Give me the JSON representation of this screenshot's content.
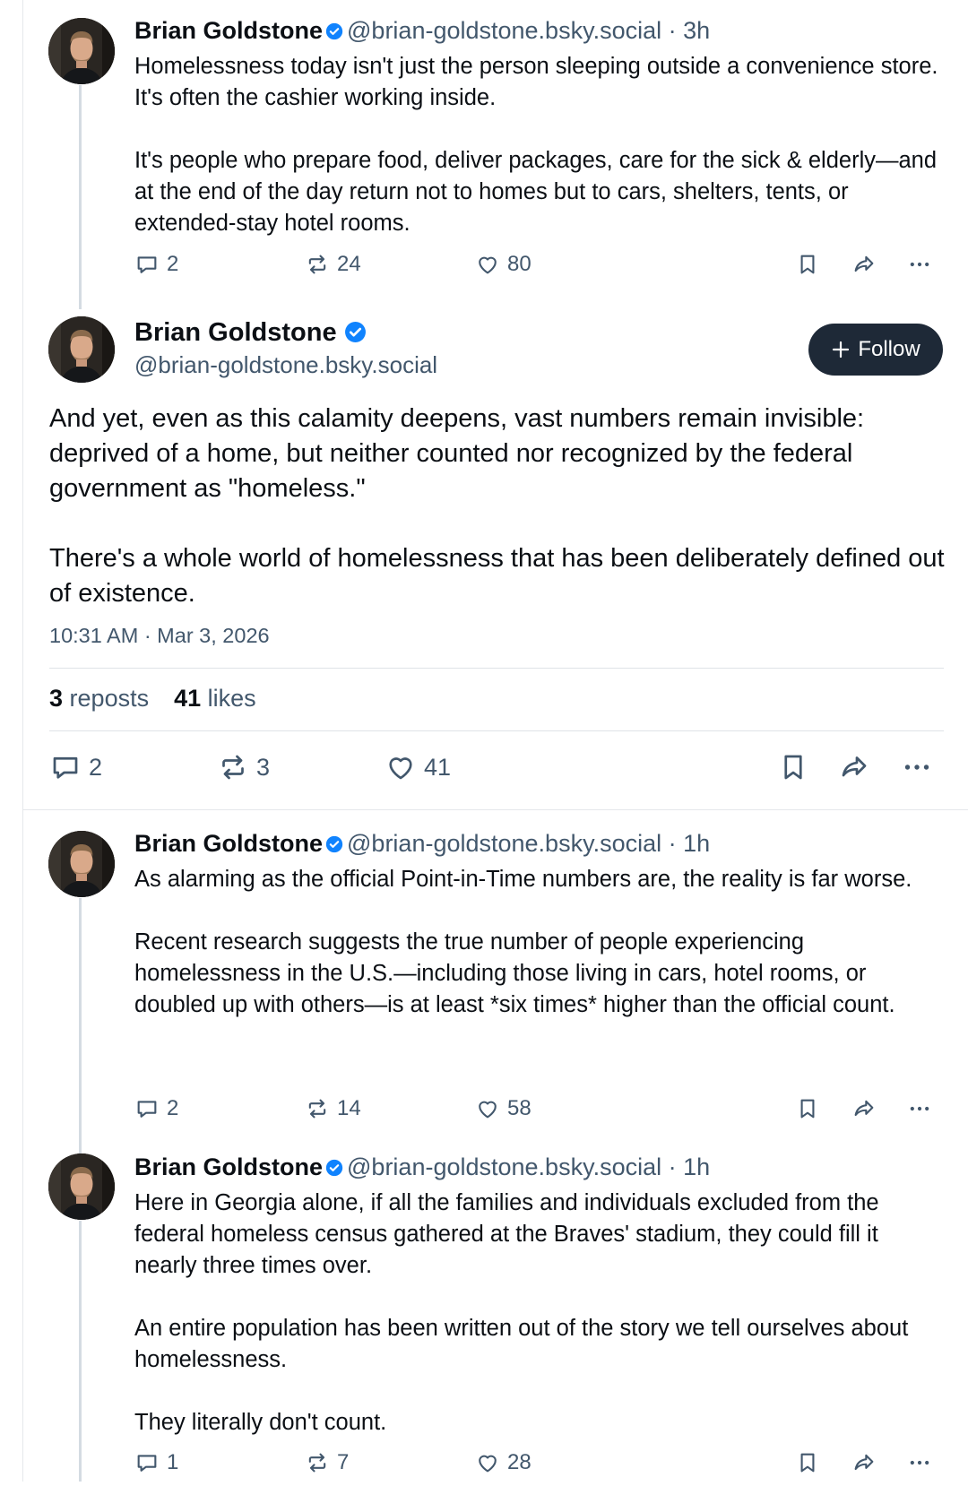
{
  "author": {
    "name": "Brian Goldstone",
    "handle": "@brian-goldstone.bsky.social",
    "verified": true
  },
  "colors": {
    "verified_badge": "#1083fe",
    "follow_bg": "#1e2937",
    "muted": "#42576c"
  },
  "icons": {
    "reply": "reply-icon",
    "repost": "repost-icon",
    "like": "heart-icon",
    "bookmark": "bookmark-icon",
    "share": "share-icon",
    "more": "more-icon",
    "verified": "verified-badge-icon",
    "follow": "plus-icon"
  },
  "parent_post": {
    "time": "3h",
    "text": "Homelessness today isn't just the person sleeping outside a convenience store. It's often the cashier working inside.\n\nIt's people who prepare food, deliver packages, care for the sick & elderly—and at the end of the day return not to homes but to cars, shelters, tents, or extended-stay hotel rooms.",
    "replies": "2",
    "reposts": "24",
    "likes": "80"
  },
  "main_post": {
    "follow_label": "Follow",
    "text": "And yet, even as this calamity deepens, vast numbers remain invisible: deprived of a home, but neither counted nor recognized by the federal government as \"homeless.\"\n\nThere's a whole world of homelessness that has been deliberately defined out of existence.",
    "timestamp": "10:31 AM · Mar 3, 2026",
    "repost_count": "3",
    "repost_label": "reposts",
    "like_count": "41",
    "like_label": "likes",
    "replies": "2",
    "reposts": "3",
    "likes": "41"
  },
  "reply_1": {
    "time": "1h",
    "text": "As alarming as the official Point-in-Time numbers are, the reality is far worse.\n\nRecent research suggests the true number of people experiencing homelessness in the U.S.—including those living in cars, hotel rooms, or doubled up with others—is at least *six times* higher than the official count.",
    "replies": "2",
    "reposts": "14",
    "likes": "58"
  },
  "reply_2": {
    "time": "1h",
    "text": "Here in Georgia alone, if all the families and individuals excluded from the federal homeless census gathered at the Braves' stadium, they could fill it nearly three times over.\n\nAn entire population has been written out of the story we tell ourselves about homelessness.\n\nThey literally don't count.",
    "replies": "1",
    "reposts": "7",
    "likes": "28"
  },
  "separator": "·"
}
